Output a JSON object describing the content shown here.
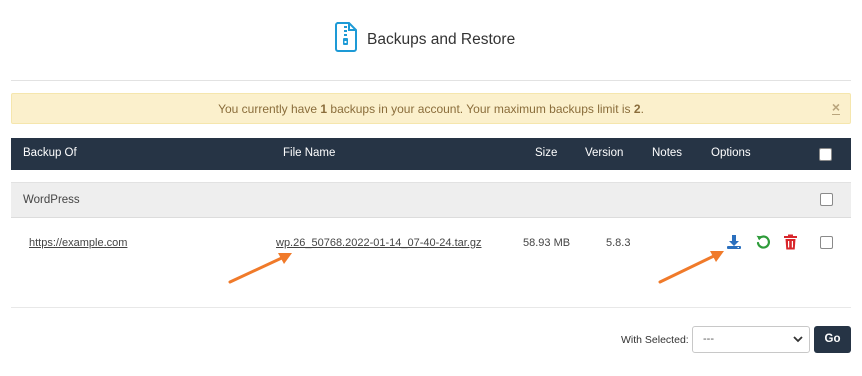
{
  "header": {
    "title": "Backups and Restore",
    "icon": "zip-file-icon"
  },
  "alert": {
    "msg_part1": "You currently have ",
    "count": "1",
    "msg_part2": " backups in your account. Your maximum backups limit is ",
    "limit": "2",
    "msg_part3": ".",
    "close": "×"
  },
  "table": {
    "columns": [
      "Backup Of",
      "File Name",
      "Size",
      "Version",
      "Notes",
      "Options"
    ],
    "groups": [
      {
        "name": "WordPress",
        "rows": [
          {
            "backup_of": "https://example.com",
            "file_name": "wp.26_50768.2022-01-14_07-40-24.tar.gz",
            "size": "58.93 MB",
            "version": "5.8.3",
            "notes": ""
          }
        ]
      }
    ]
  },
  "footer": {
    "with_selected": "With Selected:",
    "select_value": "---",
    "go": "Go"
  },
  "colors": {
    "header_bg": "#263445",
    "alert_bg": "#fbf0cc",
    "download": "#2a6fbe",
    "restore": "#2e9b3a",
    "delete": "#d9262b",
    "annotation_arrow": "#f07a2a"
  }
}
